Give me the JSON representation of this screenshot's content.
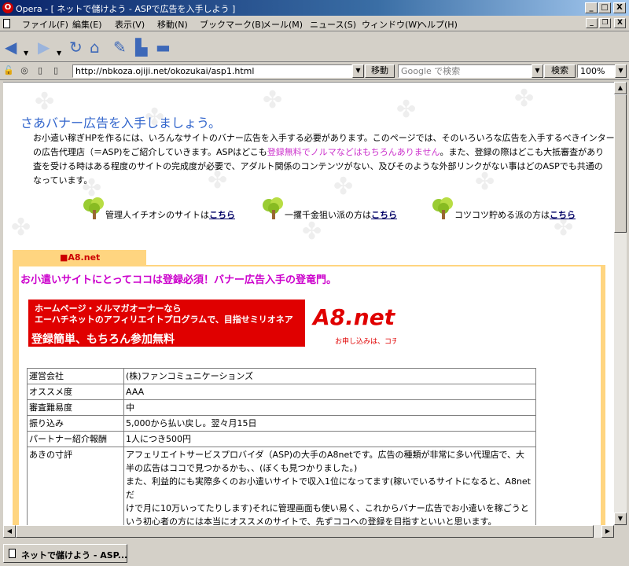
{
  "window": {
    "title": "Opera - [ ネットで儲けよう - ASPで広告を入手しよう ]",
    "controls": {
      "minimize": "_",
      "maximize": "□",
      "close": "X"
    }
  },
  "menu": {
    "items": [
      "ファイル(F)",
      "編集(E)",
      "表示(V)",
      "移動(N)",
      "ブックマーク(B)",
      "メール(M)",
      "ニュース(S)",
      "ウィンドウ(W)",
      "ヘルプ(H)"
    ],
    "mdi_controls": {
      "minimize": "_",
      "restore": "❐",
      "close": "X"
    }
  },
  "toolbar": {
    "icons": [
      "back-icon",
      "forward-icon",
      "reload-icon",
      "home-icon",
      "bookmarks-icon",
      "print-icon",
      "save-icon"
    ]
  },
  "address": {
    "url": "http://nbkoza.ojiji.net/okozukai/asp1.html",
    "go_label": "移動",
    "search_placeholder": "Google で検索",
    "search_label": "検索",
    "zoom": "100%"
  },
  "page": {
    "heading": "さあバナー広告を入手しましょう。",
    "intro": {
      "line1": "お小遣い稼ぎHPを作るには、いろんなサイトのバナー広告を入手する必要があります。このページでは、そのいろいろな広告を入手するべきインター",
      "line2_a": "の広告代理店（＝ASP)をご紹介していきます。ASPはどこも",
      "line2_highlight": "登録無料でノルマなどはもちろんありません",
      "line2_b": "。また、登録の際はどこも大抵審査があり",
      "line3": "査を受ける時はある程度のサイトの完成度が必要で、アダルト関係のコンテンツがない、及びそのような外部リンクがない事はどのASPでも共通の",
      "line4": "なっています。"
    },
    "links": [
      {
        "text": "管理人イチオシのサイトは",
        "link": "こちら"
      },
      {
        "text": "一攫千金狙い派の方は",
        "link": "こちら"
      },
      {
        "text": "コツコツ貯める派の方は",
        "link": "こちら"
      }
    ],
    "section": {
      "tab": "■A8.net",
      "catch": "お小遣いサイトにとってココは登録必須！バナー広告入手の登竜門。",
      "banner": {
        "line1": "ホームページ・メルマガオーナーなら",
        "line2": "エーハチネットのアフィリエイトプログラムで、目指せミリオネア",
        "line3": "登録簡単、もちろん参加無料",
        "logo": "A8.net",
        "logo_sub": "お申し込みは、コチラから"
      },
      "table": [
        {
          "key": "運営会社",
          "value": "(株)ファンコミュニケーションズ"
        },
        {
          "key": "オススメ度",
          "value": "AAA"
        },
        {
          "key": "審査難易度",
          "value": "中"
        },
        {
          "key": "振り込み",
          "value": "5,000から払い戻し。翌々月15日"
        },
        {
          "key": "パートナー紹介報酬",
          "value": "1人につき500円"
        },
        {
          "key": "あきの寸評",
          "lines": [
            "アフェリエイトサービスプロバイダ（ASP)の大手のA8netです。広告の種類が非常に多い代理店で、大",
            "半の広告はココで見つかるかも、、(ぼくも見つかりました。)",
            "また、利益的にも実際多くのお小遣いサイトで収入1位になってます(稼いでいるサイトになると、A8netだ",
            "けで月に10万いってたりします)それに管理画面も使い易く、これからバナー広告でお小遣いを稼ごうと",
            "いう初心者の方には本当にオススメのサイトで、先ずココへの登録を目指すといいと思います。"
          ]
        }
      ]
    }
  },
  "status": {
    "tab_label": "ネットで儲けよう - ASP..."
  }
}
